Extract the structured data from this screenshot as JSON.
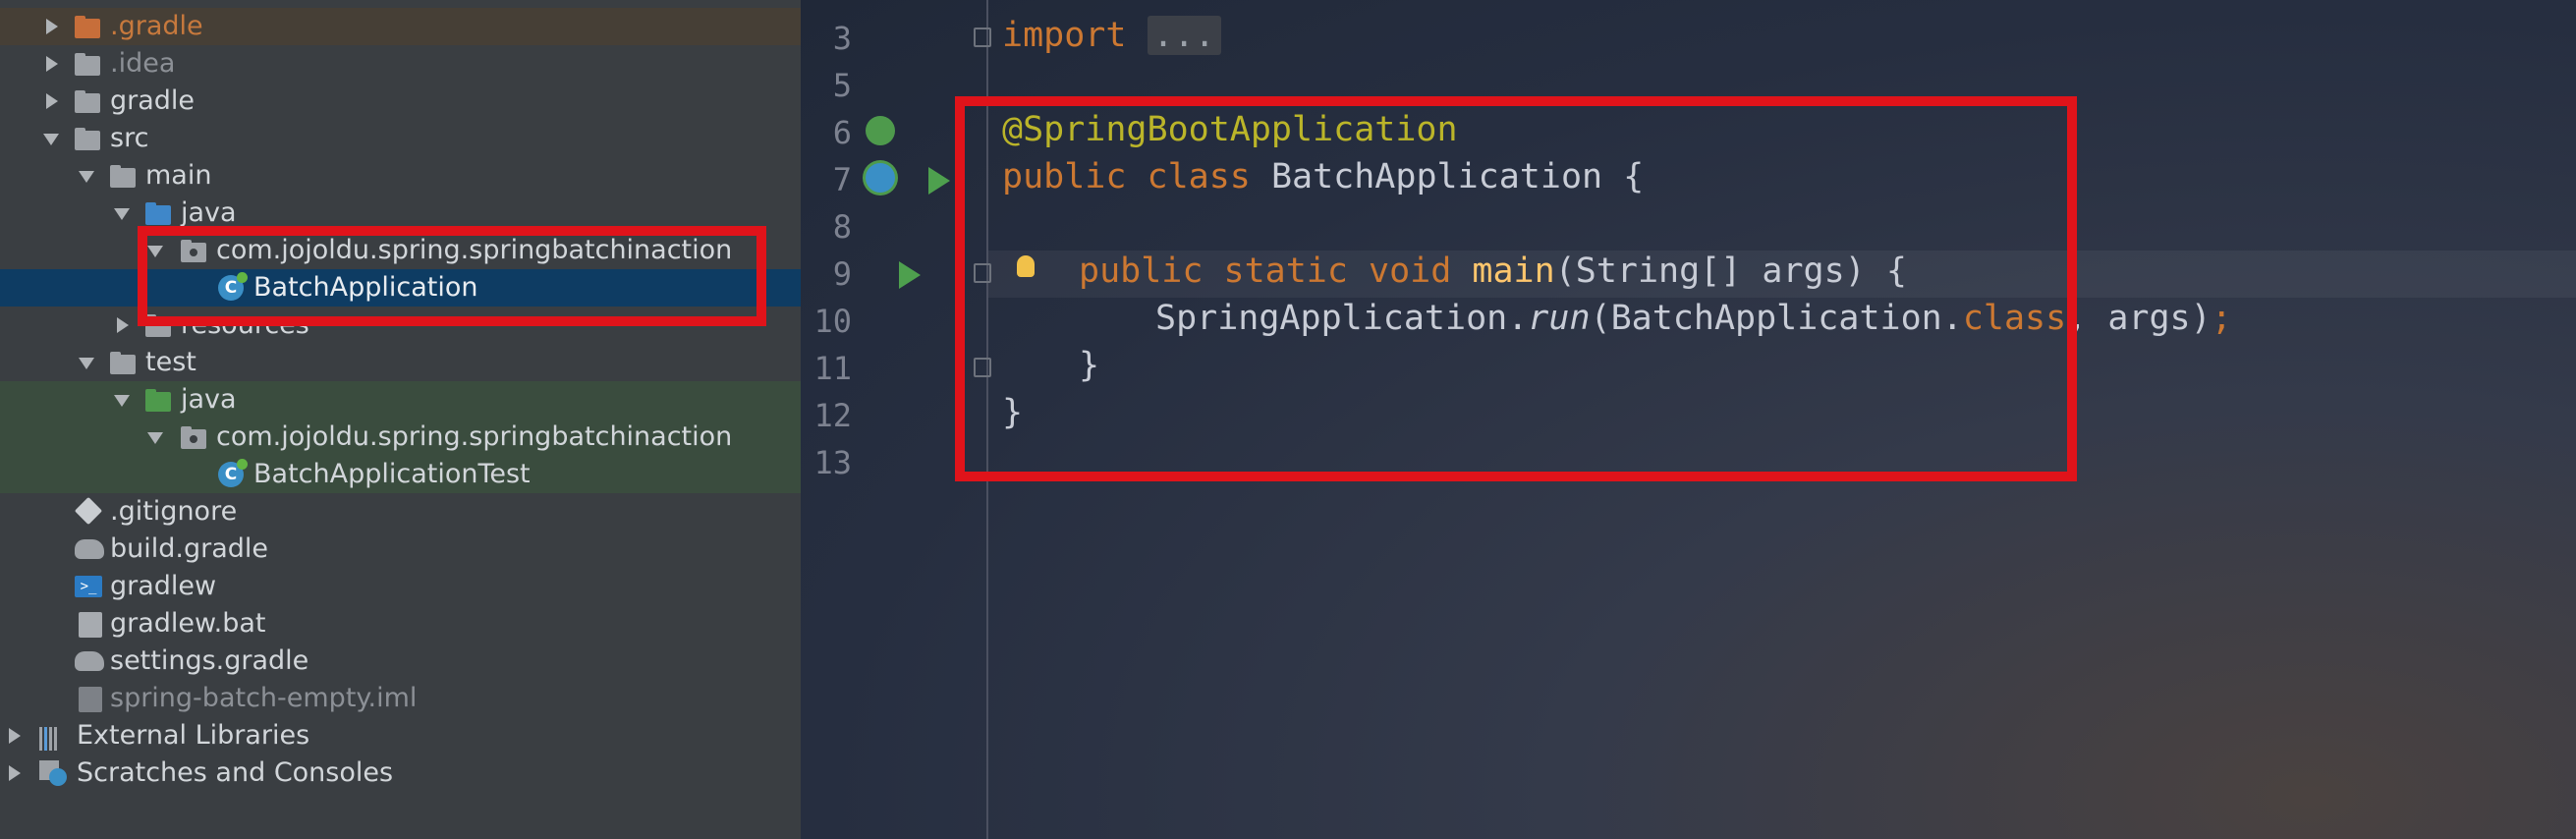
{
  "tree": {
    "items": [
      {
        "label": ".gradle",
        "style": "orange"
      },
      {
        "label": ".idea"
      },
      {
        "label": "gradle"
      },
      {
        "label": "src"
      },
      {
        "label": "main"
      },
      {
        "label": "java"
      },
      {
        "label": "com.jojoldu.spring.springbatchinaction"
      },
      {
        "label": "BatchApplication"
      },
      {
        "label": "resources"
      },
      {
        "label": "test"
      },
      {
        "label": "java"
      },
      {
        "label": "com.jojoldu.spring.springbatchinaction"
      },
      {
        "label": "BatchApplicationTest"
      },
      {
        "label": ".gitignore"
      },
      {
        "label": "build.gradle"
      },
      {
        "label": "gradlew"
      },
      {
        "label": "gradlew.bat"
      },
      {
        "label": "settings.gradle"
      },
      {
        "label": "spring-batch-empty.iml",
        "style": "dim"
      },
      {
        "label": "External Libraries"
      },
      {
        "label": "Scratches and Consoles"
      }
    ],
    "selected": "BatchApplication"
  },
  "editor": {
    "line_numbers": [
      "3",
      "5",
      "6",
      "7",
      "8",
      "9",
      "10",
      "11",
      "12",
      "13"
    ],
    "code": {
      "l3_kw": "import",
      "l3_fold": "...",
      "l6_ann": "@SpringBootApplication",
      "l7_kw": "public class",
      "l7_rest": " BatchApplication {",
      "l9_kw": "public static void",
      "l9_fn": "main",
      "l9_rest": "(String[] args) {",
      "l10_a": "SpringApplication.",
      "l10_run": "run",
      "l10_b": "(BatchApplication.",
      "l10_kw": "class",
      "l10_c": ", args)",
      "l10_semi": ";",
      "l11": "}",
      "l12": "}"
    }
  },
  "colors": {
    "highlight": "#e0131a",
    "keyword": "#cc7832",
    "annotation": "#bbb529",
    "method": "#ffc66d",
    "selection": "#0e3c63"
  }
}
